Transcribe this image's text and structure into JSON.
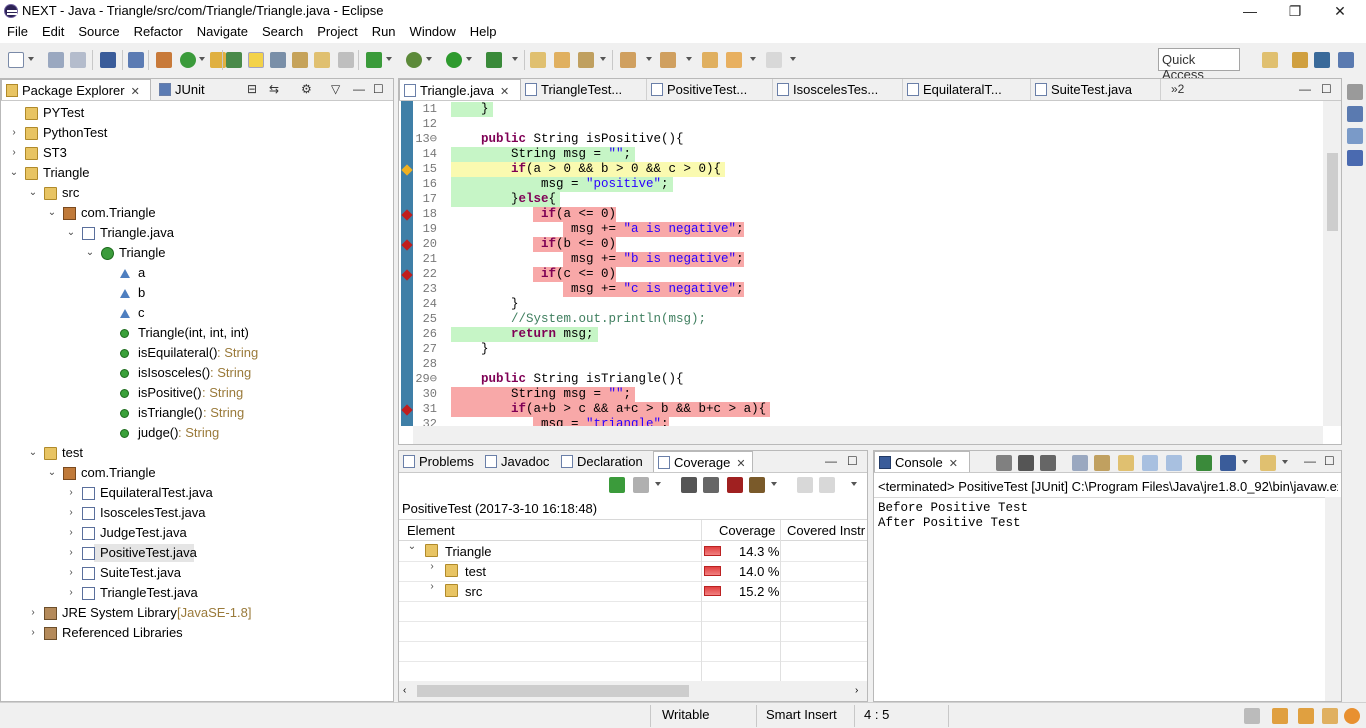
{
  "window": {
    "title": "NEXT - Java - Triangle/src/com/Triangle/Triangle.java - Eclipse",
    "min": "—",
    "max": "❐",
    "close": "✕"
  },
  "menu": [
    "File",
    "Edit",
    "Source",
    "Refactor",
    "Navigate",
    "Search",
    "Project",
    "Run",
    "Window",
    "Help"
  ],
  "toolbar": {
    "quick_access": "Quick Access"
  },
  "explorer": {
    "tabs": [
      {
        "label": "Package Explorer"
      },
      {
        "label": "JUnit"
      }
    ],
    "tree": [
      {
        "label": "PYTest",
        "icon": "folder",
        "level": 0,
        "arrow": ""
      },
      {
        "label": "PythonTest",
        "icon": "folder",
        "level": 0,
        "arrow": "›"
      },
      {
        "label": "ST3",
        "icon": "folder",
        "level": 0,
        "arrow": "›"
      },
      {
        "label": "Triangle",
        "icon": "proj",
        "level": 0,
        "arrow": "⌄"
      },
      {
        "label": "src",
        "icon": "folder",
        "level": 1,
        "arrow": "⌄"
      },
      {
        "label": "com.Triangle",
        "icon": "pkg",
        "level": 2,
        "arrow": "⌄"
      },
      {
        "label": "Triangle.java",
        "icon": "file",
        "level": 3,
        "arrow": "⌄"
      },
      {
        "label": "Triangle",
        "icon": "cls",
        "level": 4,
        "arrow": "⌄"
      },
      {
        "label": "a",
        "icon": "fld",
        "level": 5,
        "arrow": ""
      },
      {
        "label": "b",
        "icon": "fld",
        "level": 5,
        "arrow": ""
      },
      {
        "label": "c",
        "icon": "fld",
        "level": 5,
        "arrow": ""
      },
      {
        "label": "Triangle(int, int, int)",
        "icon": "meth",
        "level": 5,
        "arrow": ""
      },
      {
        "label": "isEquilateral()",
        "ret": " : String",
        "icon": "meth",
        "level": 5,
        "arrow": ""
      },
      {
        "label": "isIsosceles()",
        "ret": " : String",
        "icon": "meth",
        "level": 5,
        "arrow": ""
      },
      {
        "label": "isPositive()",
        "ret": " : String",
        "icon": "meth",
        "level": 5,
        "arrow": ""
      },
      {
        "label": "isTriangle()",
        "ret": " : String",
        "icon": "meth",
        "level": 5,
        "arrow": ""
      },
      {
        "label": "judge()",
        "ret": " : String",
        "icon": "meth",
        "level": 5,
        "arrow": ""
      },
      {
        "label": "test",
        "icon": "folder",
        "level": 1,
        "arrow": "⌄"
      },
      {
        "label": "com.Triangle",
        "icon": "pkg",
        "level": 2,
        "arrow": "⌄"
      },
      {
        "label": "EquilateralTest.java",
        "icon": "file",
        "level": 3,
        "arrow": "›"
      },
      {
        "label": "IsoscelesTest.java",
        "icon": "file",
        "level": 3,
        "arrow": "›"
      },
      {
        "label": "JudgeTest.java",
        "icon": "file",
        "level": 3,
        "arrow": "›"
      },
      {
        "label": "PositiveTest.java",
        "icon": "file",
        "level": 3,
        "arrow": "›",
        "selected": true
      },
      {
        "label": "SuiteTest.java",
        "icon": "file",
        "level": 3,
        "arrow": "›"
      },
      {
        "label": "TriangleTest.java",
        "icon": "file",
        "level": 3,
        "arrow": "›"
      },
      {
        "label": "JRE System Library",
        "ret": " [JavaSE-1.8]",
        "icon": "lib",
        "level": 1,
        "arrow": "›"
      },
      {
        "label": "Referenced Libraries",
        "icon": "lib",
        "level": 1,
        "arrow": "›"
      }
    ]
  },
  "editor": {
    "tabs": [
      {
        "label": "Triangle.java",
        "active": true
      },
      {
        "label": "TriangleTest..."
      },
      {
        "label": "PositiveTest..."
      },
      {
        "label": "IsoscelesTes..."
      },
      {
        "label": "EquilateralT..."
      },
      {
        "label": "SuiteTest.java"
      }
    ],
    "overflow": "»2",
    "lines": [
      {
        "n": "11",
        "hl": "green",
        "text": "    }"
      },
      {
        "n": "12",
        "hl": "",
        "text": ""
      },
      {
        "n": "13⊖",
        "hl": "",
        "text": "    public String isPositive(){"
      },
      {
        "n": "14",
        "hl": "green",
        "text": "        String msg = \"\";"
      },
      {
        "n": "15",
        "hl": "yellow",
        "bp": "yellow",
        "text": "        if(a > 0 && b > 0 && c > 0){"
      },
      {
        "n": "16",
        "hl": "green",
        "text": "            msg = \"positive\";"
      },
      {
        "n": "17",
        "hl": "green",
        "text": "        }else{"
      },
      {
        "n": "18",
        "hl": "red",
        "bp": "red",
        "text": "            if(a <= 0)"
      },
      {
        "n": "19",
        "hl": "red",
        "text": "                msg += \"a is negative\";"
      },
      {
        "n": "20",
        "hl": "red",
        "bp": "red",
        "text": "            if(b <= 0)"
      },
      {
        "n": "21",
        "hl": "red",
        "text": "                msg += \"b is negative\";"
      },
      {
        "n": "22",
        "hl": "red",
        "bp": "red",
        "text": "            if(c <= 0)"
      },
      {
        "n": "23",
        "hl": "red",
        "text": "                msg += \"c is negative\";"
      },
      {
        "n": "24",
        "hl": "",
        "text": "        }"
      },
      {
        "n": "25",
        "hl": "",
        "text": "        //System.out.println(msg);"
      },
      {
        "n": "26",
        "hl": "green",
        "text": "        return msg;"
      },
      {
        "n": "27",
        "hl": "",
        "text": "    }"
      },
      {
        "n": "28",
        "hl": "",
        "text": ""
      },
      {
        "n": "29⊖",
        "hl": "",
        "text": "    public String isTriangle(){"
      },
      {
        "n": "30",
        "hl": "red",
        "text": "        String msg = \"\";"
      },
      {
        "n": "31",
        "hl": "red",
        "bp": "red",
        "text": "        if(a+b > c && a+c > b && b+c > a){"
      },
      {
        "n": "32",
        "hl": "red",
        "text": "            msg = \"triangle\";"
      }
    ]
  },
  "bottom_left": {
    "tabs": [
      {
        "label": "Problems"
      },
      {
        "label": "Javadoc"
      },
      {
        "label": "Declaration"
      },
      {
        "label": "Coverage",
        "active": true
      }
    ],
    "session": "PositiveTest (2017-3-10 16:18:48)",
    "columns": [
      "Element",
      "Coverage",
      "Covered Instr"
    ],
    "rows": [
      {
        "label": "Triangle",
        "coverage": "14.3 %",
        "pct": 14.3,
        "level": 0,
        "arrow": "⌄"
      },
      {
        "label": "test",
        "coverage": "14.0 %",
        "pct": 14.0,
        "level": 1,
        "arrow": "›"
      },
      {
        "label": "src",
        "coverage": "15.2 %",
        "pct": 15.2,
        "level": 1,
        "arrow": "›"
      }
    ]
  },
  "console": {
    "tab": "Console",
    "header": "<terminated> PositiveTest [JUnit] C:\\Program Files\\Java\\jre1.8.0_92\\bin\\javaw.ex",
    "lines": [
      "Before Positive Test",
      "After Positive Test"
    ]
  },
  "status": {
    "writable": "Writable",
    "insert": "Smart Insert",
    "position": "4 : 5"
  }
}
